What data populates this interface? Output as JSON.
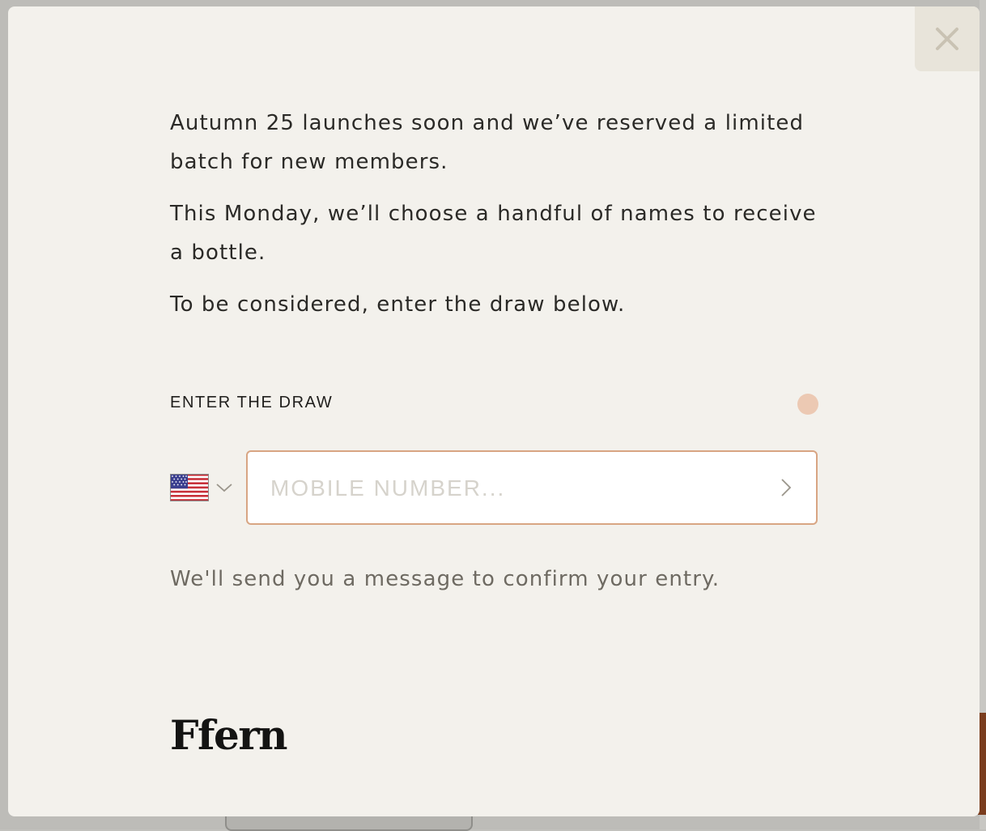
{
  "modal": {
    "close_icon": "close-icon",
    "intro": [
      "Autumn 25 launches soon and we’ve reserved a limited batch for new members.",
      "This Monday, we’ll choose a handful of names to receive a bottle.",
      "To be considered, enter the draw below."
    ],
    "draw_label": "ENTER THE DRAW",
    "phone": {
      "country_flag": "us-flag-icon",
      "placeholder": "MOBILE NUMBER...",
      "value": ""
    },
    "confirm_note": "We'll send you a message to confirm your entry.",
    "brand": "Ffern"
  },
  "colors": {
    "accent_border": "#d8a583",
    "status_dot": "#ecc9b3",
    "modal_bg": "#f3f1ec"
  }
}
